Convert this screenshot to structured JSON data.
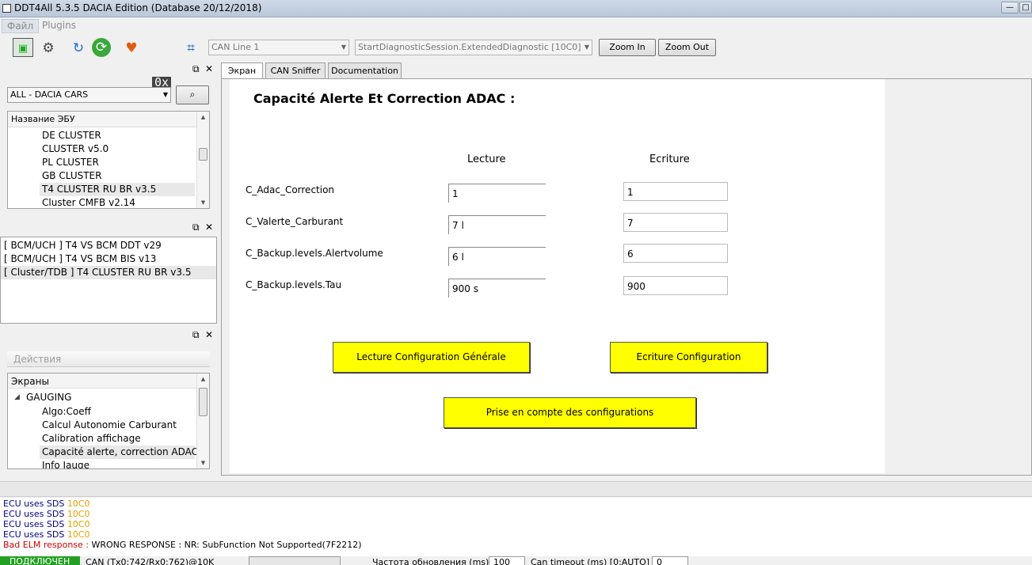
{
  "window": {
    "title": "DDT4All 5.3.5 DACIA Edition (Database 20/12/2018)",
    "min": "—",
    "max": "□"
  },
  "menu": [
    "Файл",
    "Plugins"
  ],
  "toolbar": {
    "can_line": "CAN Line 1",
    "session": "StartDiagnosticSession.ExtendedDiagnostic [10C0]",
    "zoom_in": "Zoom In",
    "zoom_out": "Zoom Out",
    "hex_label": "0x"
  },
  "ecu_panel": {
    "filter": "ALL - DACIA CARS",
    "header": "Название ЭБУ",
    "items": [
      "DE CLUSTER",
      "CLUSTER v5.0",
      "PL CLUSTER",
      "GB CLUSTER",
      "T4 CLUSTER RU BR v3.5",
      "Cluster CMFB v2.14"
    ],
    "selected_index": 4
  },
  "vehicle_panel": {
    "items": [
      "[ BCM/UCH ] T4 VS BCM DDT v29",
      "[ BCM/UCH ] T4 VS BCM BIS v13",
      "[ Cluster/TDB ] T4 CLUSTER RU BR v3.5"
    ],
    "selected_index": 2
  },
  "actions_panel": {
    "title": "Действия",
    "header": "Экраны",
    "group": "GAUGING",
    "items": [
      "Algo:Coeff",
      "Calcul Autonomie Carburant",
      "Calibration affichage",
      "Capacité alerte, correction ADAC",
      "Info Jauge"
    ],
    "selected_index": 3
  },
  "tabs": [
    "Экран",
    "CAN Sniffer",
    "Documentation"
  ],
  "screen": {
    "title": "Capacité Alerte Et Correction ADAC :",
    "col_read": "Lecture",
    "col_write": "Ecriture",
    "params": [
      {
        "name": "C_Adac_Correction",
        "read": "1",
        "write": "1"
      },
      {
        "name": "C_Valerte_Carburant",
        "read": "7 l",
        "write": "7"
      },
      {
        "name": "C_Backup.levels.Alertvolume",
        "read": "6 l",
        "write": "6"
      },
      {
        "name": "C_Backup.levels.Tau",
        "read": "900 s",
        "write": "900"
      }
    ],
    "btn_read_config": "Lecture Configuration Générale",
    "btn_write_config": "Ecriture Configuration",
    "btn_apply": "Prise en compte des configurations"
  },
  "log": [
    {
      "text": "ECU uses SDS ",
      "code": "10C0"
    },
    {
      "text": "ECU uses SDS ",
      "code": "10C0"
    },
    {
      "text": "ECU uses SDS ",
      "code": "10C0"
    },
    {
      "text": "ECU uses SDS ",
      "code": "10C0"
    },
    {
      "text": "Bad ELM response :",
      "code": " WRONG RESPONSE : NR: SubFunction Not Supported(7F2212)"
    }
  ],
  "status": {
    "connected": "ПОДКЛЮЧЕН",
    "can_info": "CAN (Tx0:742/Rx0:762)@10K",
    "refresh_label": "Частота обновления (ms):",
    "refresh_value": "100",
    "timeout_label": "Can timeout (ms) [0:AUTO] :",
    "timeout_value": "0"
  },
  "colors": {
    "highlight": "#ffff00",
    "log_blue": "#00008b",
    "log_orange": "#e8a000",
    "log_red": "#d00000",
    "status_green": "#22a022"
  }
}
